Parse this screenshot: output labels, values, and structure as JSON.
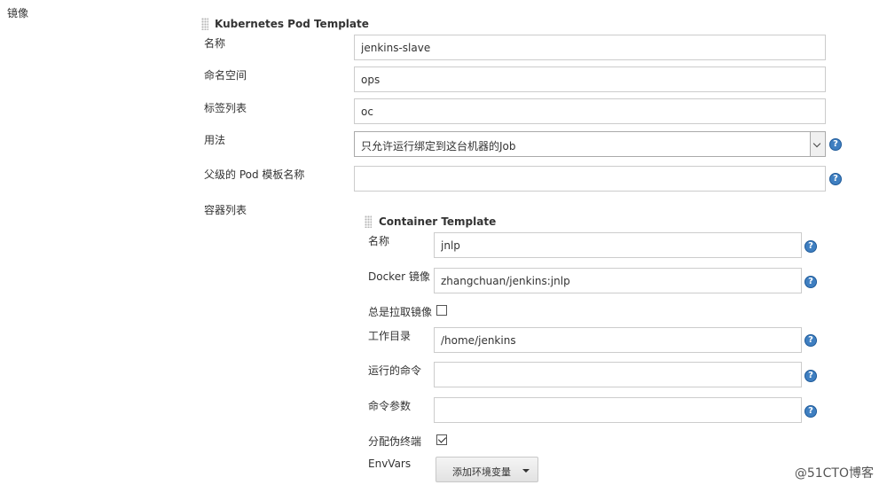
{
  "section_label": "镜像",
  "pod_template": {
    "title": "Kubernetes Pod Template",
    "fields": {
      "name_label": "名称",
      "name_value": "jenkins-slave",
      "namespace_label": "命名空间",
      "namespace_value": "ops",
      "labels_label": "标签列表",
      "labels_value": "oc",
      "usage_label": "用法",
      "usage_value": "只允许运行绑定到这台机器的Job",
      "parent_label": "父级的 Pod 模板名称",
      "parent_value": "",
      "containers_label": "容器列表"
    }
  },
  "container_template": {
    "title": "Container Template",
    "name_label": "名称",
    "name_value": "jnlp",
    "image_label": "Docker 镜像",
    "image_value": "zhangchuan/jenkins:jnlp",
    "always_pull_label": "总是拉取镜像",
    "always_pull_checked": false,
    "workdir_label": "工作目录",
    "workdir_value": "/home/jenkins",
    "command_label": "运行的命令",
    "command_value": "",
    "args_label": "命令参数",
    "args_value": "",
    "tty_label": "分配伪终端",
    "tty_checked": true,
    "envvars_label": "EnvVars",
    "add_env_button": "添加环境变量"
  },
  "help_glyph": "?",
  "watermark": "@51CTO博客"
}
